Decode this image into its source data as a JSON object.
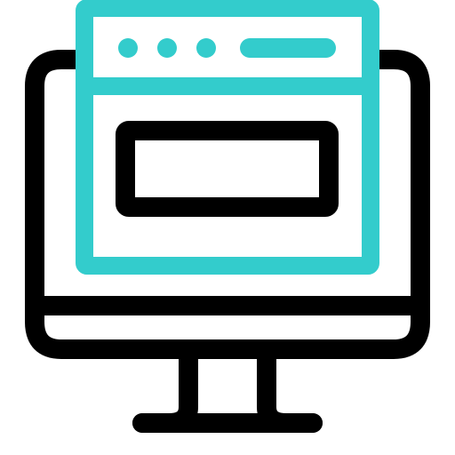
{
  "icon": {
    "name": "web-browser-on-monitor-icon",
    "colors": {
      "outline": "#000000",
      "accent": "#33CCCC",
      "background": "#FFFFFF"
    },
    "browser_window": {
      "control_dots": 3,
      "has_address_bar": true,
      "content_block": "rectangle"
    },
    "monitor": {
      "has_stand": true,
      "has_bezel_line": true
    }
  }
}
